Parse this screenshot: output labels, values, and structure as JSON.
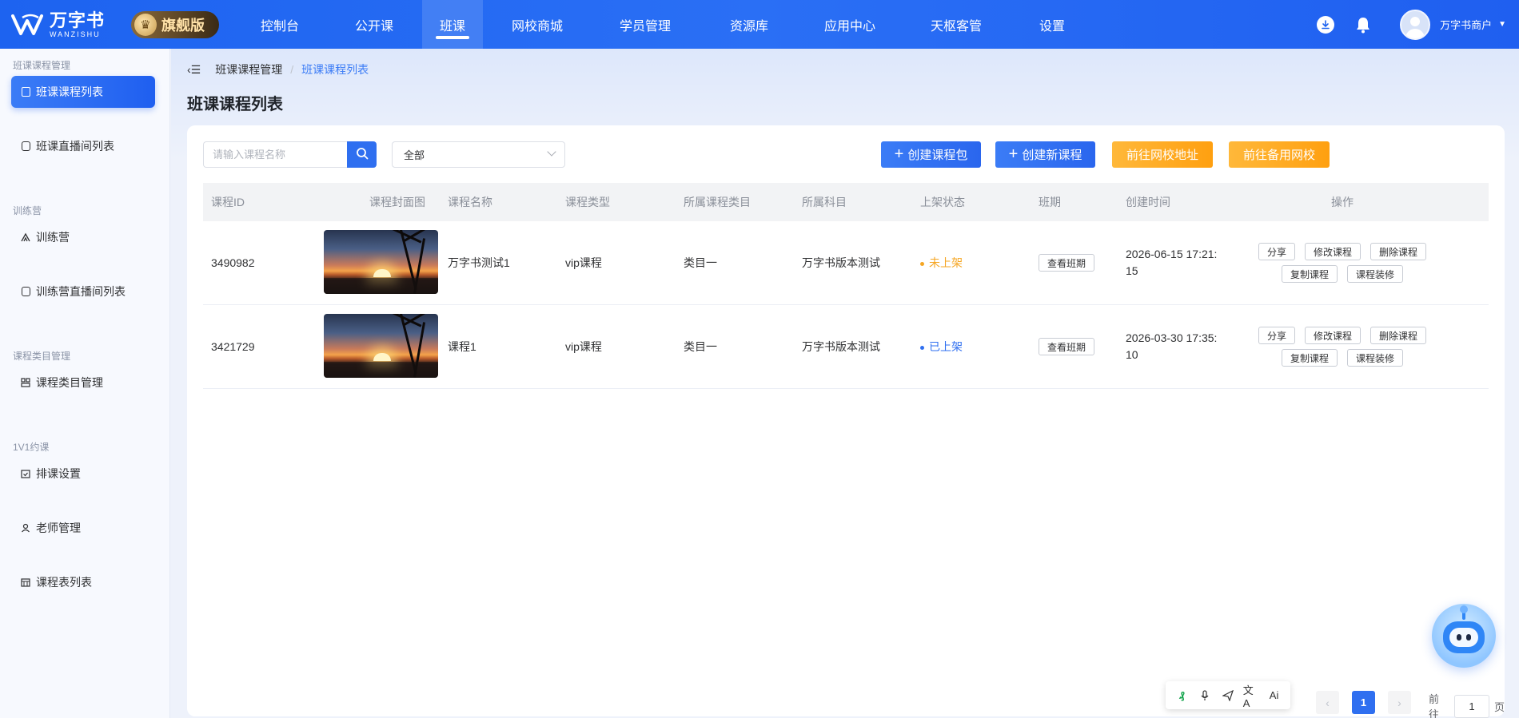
{
  "brand": {
    "name_cn": "万字书",
    "name_en": "WANZISHU",
    "edition": "旗舰版",
    "accent": "#1d63f0"
  },
  "nav": [
    {
      "label": "控制台"
    },
    {
      "label": "公开课"
    },
    {
      "label": "班课",
      "active": true
    },
    {
      "label": "网校商城"
    },
    {
      "label": "学员管理"
    },
    {
      "label": "资源库"
    },
    {
      "label": "应用中心"
    },
    {
      "label": "天枢客管"
    },
    {
      "label": "设置"
    }
  ],
  "user": {
    "name": "万字书商户"
  },
  "sidebar": {
    "groups": [
      {
        "title": "班课课程管理",
        "items": [
          {
            "label": "班课课程列表",
            "active": true,
            "icon": "book-icon"
          },
          {
            "label": "班课直播间列表",
            "icon": "live-icon"
          }
        ]
      },
      {
        "title": "训练营",
        "items": [
          {
            "label": "训练营",
            "icon": "camp-icon"
          },
          {
            "label": "训练营直播间列表",
            "icon": "live-icon"
          }
        ]
      },
      {
        "title": "课程类目管理",
        "items": [
          {
            "label": "课程类目管理",
            "icon": "category-icon"
          }
        ]
      },
      {
        "title": "1V1约课",
        "items": [
          {
            "label": "排课设置",
            "icon": "calendar-check-icon"
          },
          {
            "label": "老师管理",
            "icon": "user-icon"
          },
          {
            "label": "课程表列表",
            "icon": "calendar-icon"
          }
        ]
      }
    ]
  },
  "breadcrumb": {
    "parent": "班课课程管理",
    "current": "班课课程列表"
  },
  "page_title": "班课课程列表",
  "filters": {
    "search_placeholder": "请输入课程名称",
    "select_value": "全部"
  },
  "actions": {
    "create_package": "创建课程包",
    "create_course": "创建新课程",
    "goto_school": "前往网校地址",
    "goto_backup": "前往备用网校"
  },
  "table": {
    "headers": [
      "课程ID",
      "课程封面图",
      "课程名称",
      "课程类型",
      "所属课程类目",
      "所属科目",
      "上架状态",
      "班期",
      "创建时间",
      "操作"
    ],
    "rows": [
      {
        "id": "3490982",
        "name": "万字书测试1",
        "type": "vip课程",
        "category": "类目一",
        "subject": "万字书版本测试",
        "status": "未上架",
        "status_color": "#f5a623",
        "class_btn": "查看班期",
        "created_date": "2026-06-15 17:21:",
        "created_time": "15"
      },
      {
        "id": "3421729",
        "name": "课程1",
        "type": "vip课程",
        "category": "类目一",
        "subject": "万字书版本测试",
        "status": "已上架",
        "status_color": "#2f6ff0",
        "class_btn": "查看班期",
        "created_date": "2026-03-30 17:35:",
        "created_time": "10"
      }
    ],
    "row_actions": {
      "share": "分享",
      "edit": "修改课程",
      "delete": "删除课程",
      "copy": "复制课程",
      "decorate": "课程装修"
    }
  },
  "pagination": {
    "current_page": "1",
    "goto_label": "前往",
    "goto_value": "1",
    "page_unit": "页"
  }
}
